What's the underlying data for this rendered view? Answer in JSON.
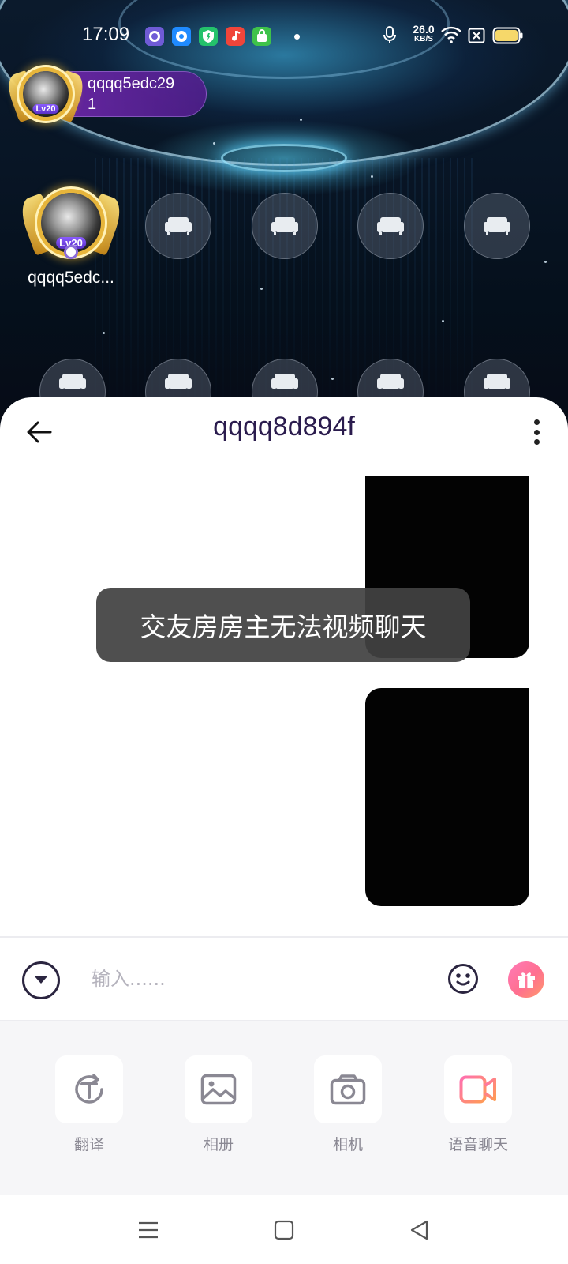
{
  "status_bar": {
    "time": "17:09",
    "net_speed_value": "26.0",
    "net_speed_unit": "KB/S",
    "app_icons": [
      "app-notification-icon-1",
      "app-notification-icon-2",
      "shield-app-icon",
      "music-app-icon",
      "store-app-icon"
    ],
    "indicators": [
      "microphone-icon",
      "wifi-icon",
      "sim-blocked-icon",
      "battery-icon"
    ]
  },
  "room": {
    "host": {
      "name": "qqqq5edc29",
      "sub": "1",
      "level": "Lv20"
    },
    "owner_seat": {
      "name": "qqqq5edc...",
      "level": "Lv20"
    },
    "empty_seat_icon": "sofa-icon"
  },
  "chat": {
    "title": "qqqq8d894f",
    "back_icon": "arrow-left-icon",
    "more_icon": "more-vertical-icon",
    "toast": "交友房房主无法视频聊天"
  },
  "input": {
    "placeholder": "输入......",
    "collapse_icon": "chevron-down-circle-icon",
    "emoji_icon": "smiley-icon",
    "gift_icon": "gift-icon"
  },
  "tools": [
    {
      "label": "翻译",
      "icon": "translate-icon"
    },
    {
      "label": "相册",
      "icon": "image-icon"
    },
    {
      "label": "相机",
      "icon": "camera-icon"
    },
    {
      "label": "语音聊天",
      "icon": "video-call-icon"
    }
  ],
  "nav": {
    "icons": [
      "menu-icon",
      "home-square-icon",
      "back-triangle-icon"
    ]
  },
  "colors": {
    "accent_purple": "#2a1b4d",
    "gift_gradient_start": "#ff7ab8",
    "gift_gradient_end": "#ff9a6a",
    "toast_bg": "#424242",
    "host_chip": "#6e28aa"
  }
}
